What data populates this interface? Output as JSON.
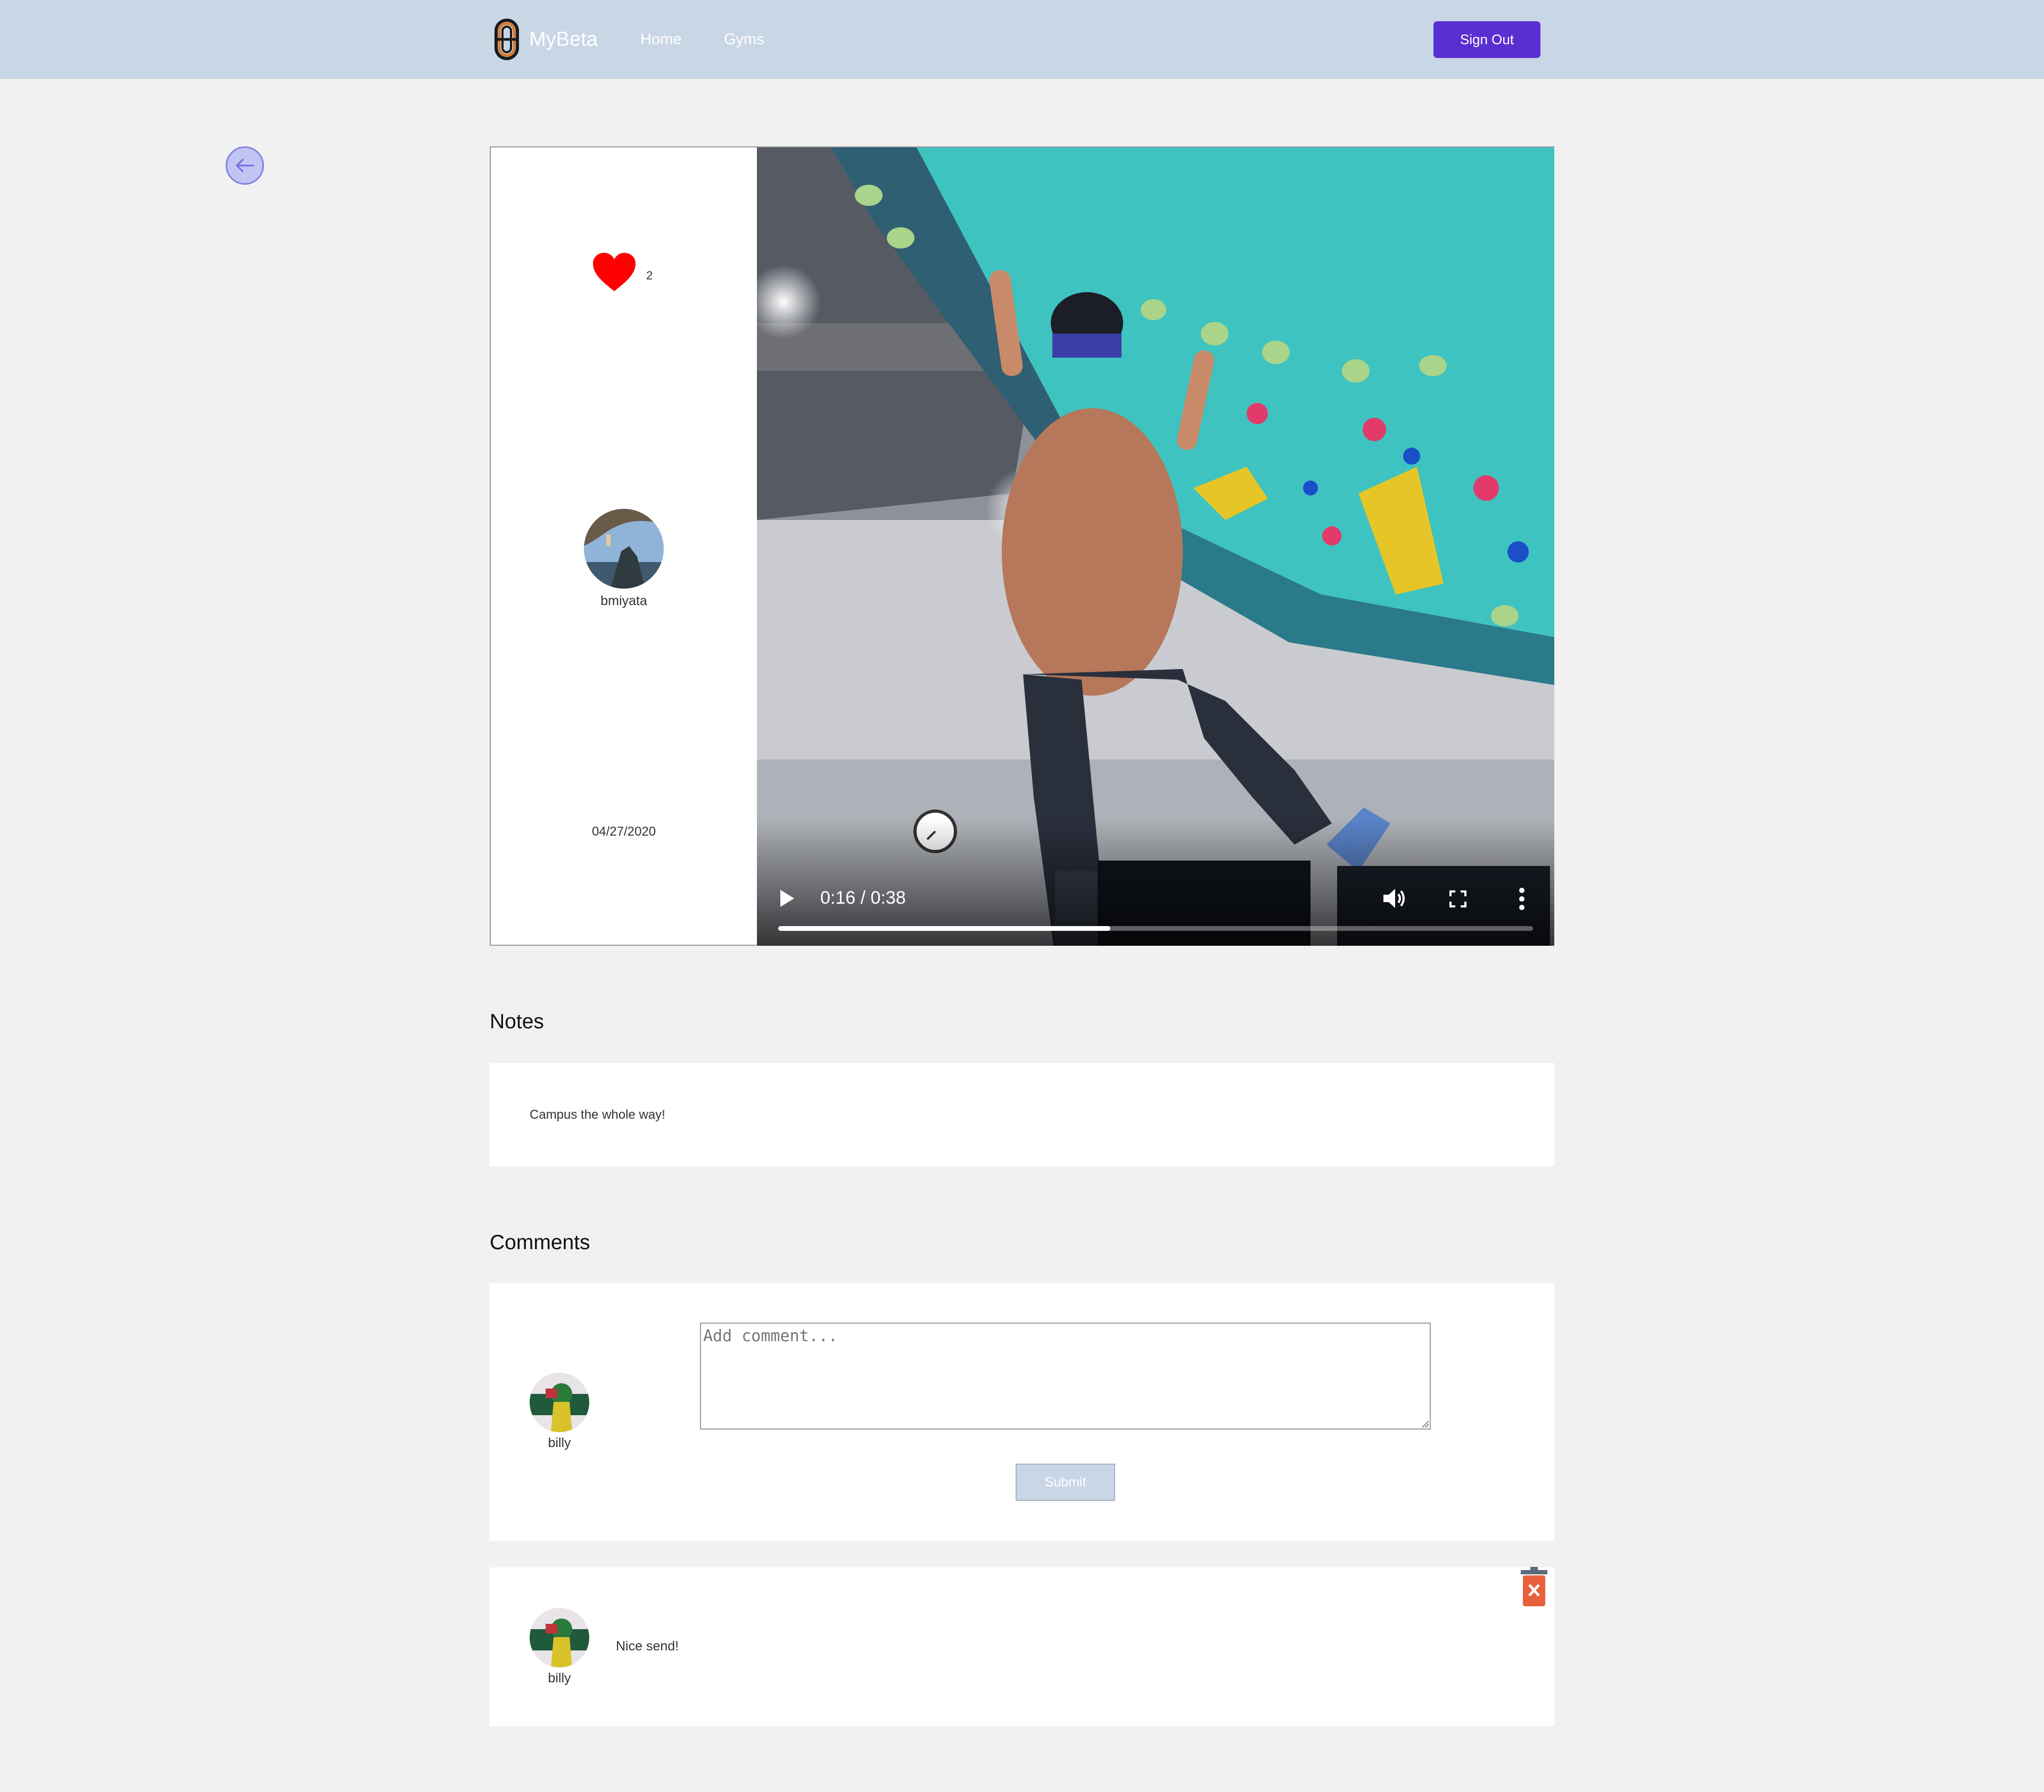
{
  "navbar": {
    "brand": "MyBeta",
    "links": [
      {
        "label": "Home"
      },
      {
        "label": "Gyms"
      }
    ],
    "sign_out_label": "Sign Out"
  },
  "post": {
    "likes": "2",
    "username": "bmiyata",
    "date": "04/27/2020",
    "video": {
      "time": "0:16 / 0:38",
      "progress_fraction": 0.44
    }
  },
  "notes": {
    "title": "Notes",
    "text": "Campus the whole way!"
  },
  "comments": {
    "title": "Comments",
    "form": {
      "username": "billy",
      "placeholder": "Add comment...",
      "submit_label": "Submit"
    },
    "items": [
      {
        "username": "billy",
        "text": "Nice send!"
      }
    ]
  },
  "colors": {
    "navbar": "#c9d6e5",
    "accent": "#5a2fd2",
    "heart": "#ff0000",
    "delete": "#e8603c"
  }
}
